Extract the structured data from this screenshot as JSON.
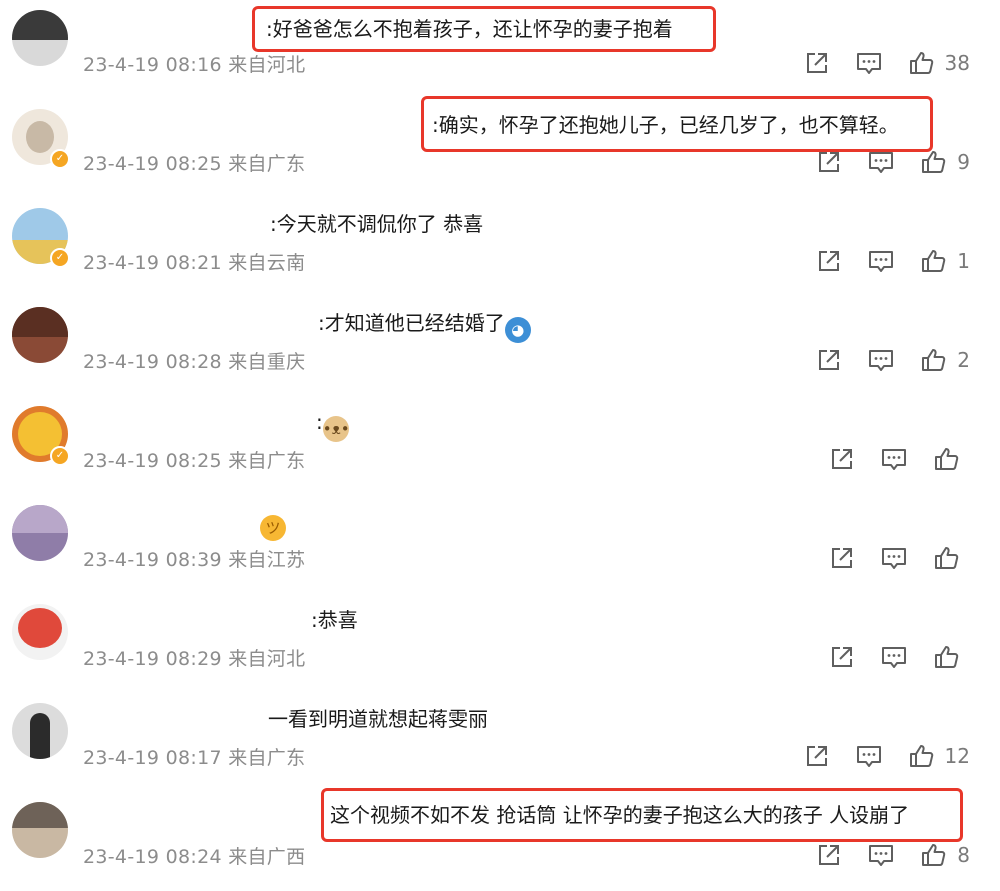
{
  "comments": [
    {
      "text": ":好爸爸怎么不抱着孩子，还让怀孕的妻子抱着",
      "emoji": "",
      "time": "23-4-19 08:16",
      "location": "来自河北",
      "likes": "38",
      "highlighted": true,
      "verified": false,
      "avatar_icon": "avatar-dark",
      "avatar_colors": [
        "#3a3a3a",
        "#d9d9d9"
      ]
    },
    {
      "text": ":确实，怀孕了还抱她儿子，已经几岁了，也不算轻。",
      "emoji": "",
      "time": "23-4-19 08:25",
      "location": "来自广东",
      "likes": "9",
      "highlighted": true,
      "verified": true,
      "avatar_icon": "avatar-baby",
      "avatar_colors": [
        "#efe7dc",
        "#c8b9a6"
      ]
    },
    {
      "text": ":今天就不调侃你了 恭喜",
      "emoji": "",
      "time": "23-4-19 08:21",
      "location": "来自云南",
      "likes": "1",
      "highlighted": false,
      "verified": true,
      "avatar_icon": "avatar-scenery",
      "avatar_colors": [
        "#9fc9e8",
        "#e6c35a"
      ]
    },
    {
      "text": ":才知道他已经结婚了",
      "emoji": "laughing-face-icon",
      "time": "23-4-19 08:28",
      "location": "来自重庆",
      "likes": "2",
      "highlighted": false,
      "verified": false,
      "avatar_icon": "avatar-brown",
      "avatar_colors": [
        "#5a2f22",
        "#8a4a36"
      ]
    },
    {
      "text": ":",
      "emoji": "doge-face-icon",
      "time": "23-4-19 08:25",
      "location": "来自广东",
      "likes": "",
      "highlighted": false,
      "verified": true,
      "avatar_icon": "avatar-yellow",
      "avatar_colors": [
        "#f4c033",
        "#e07b2c"
      ]
    },
    {
      "text": "",
      "emoji": "peeking-face-icon",
      "time": "23-4-19 08:39",
      "location": "来自江苏",
      "likes": "",
      "highlighted": false,
      "verified": false,
      "avatar_icon": "avatar-purple",
      "avatar_colors": [
        "#b8a7c9",
        "#8f7da8"
      ]
    },
    {
      "text": ":恭喜",
      "emoji": "",
      "time": "23-4-19 08:29",
      "location": "来自河北",
      "likes": "",
      "highlighted": false,
      "verified": false,
      "avatar_icon": "avatar-red",
      "avatar_colors": [
        "#e0493b",
        "#f2f2f2"
      ]
    },
    {
      "text": "一看到明道就想起蒋雯丽",
      "emoji": "",
      "time": "23-4-19 08:17",
      "location": "来自广东",
      "likes": "12",
      "highlighted": false,
      "verified": false,
      "avatar_icon": "avatar-person",
      "avatar_colors": [
        "#dcdcdc",
        "#2b2b2b"
      ]
    },
    {
      "text": "这个视频不如不发 抢话筒 让怀孕的妻子抱这么大的孩子 人设崩了",
      "emoji": "",
      "time": "23-4-19 08:24",
      "location": "来自广西",
      "likes": "8",
      "highlighted": true,
      "verified": false,
      "avatar_icon": "avatar-group",
      "avatar_colors": [
        "#6e6258",
        "#c9b8a3"
      ]
    }
  ],
  "icons": {
    "repost": "share-icon",
    "comment": "comment-icon",
    "like": "thumbs-up-icon"
  },
  "colors": {
    "highlight_border": "#e8372a",
    "meta_text": "#8c8c8c",
    "verified_badge": "#f5a623"
  }
}
